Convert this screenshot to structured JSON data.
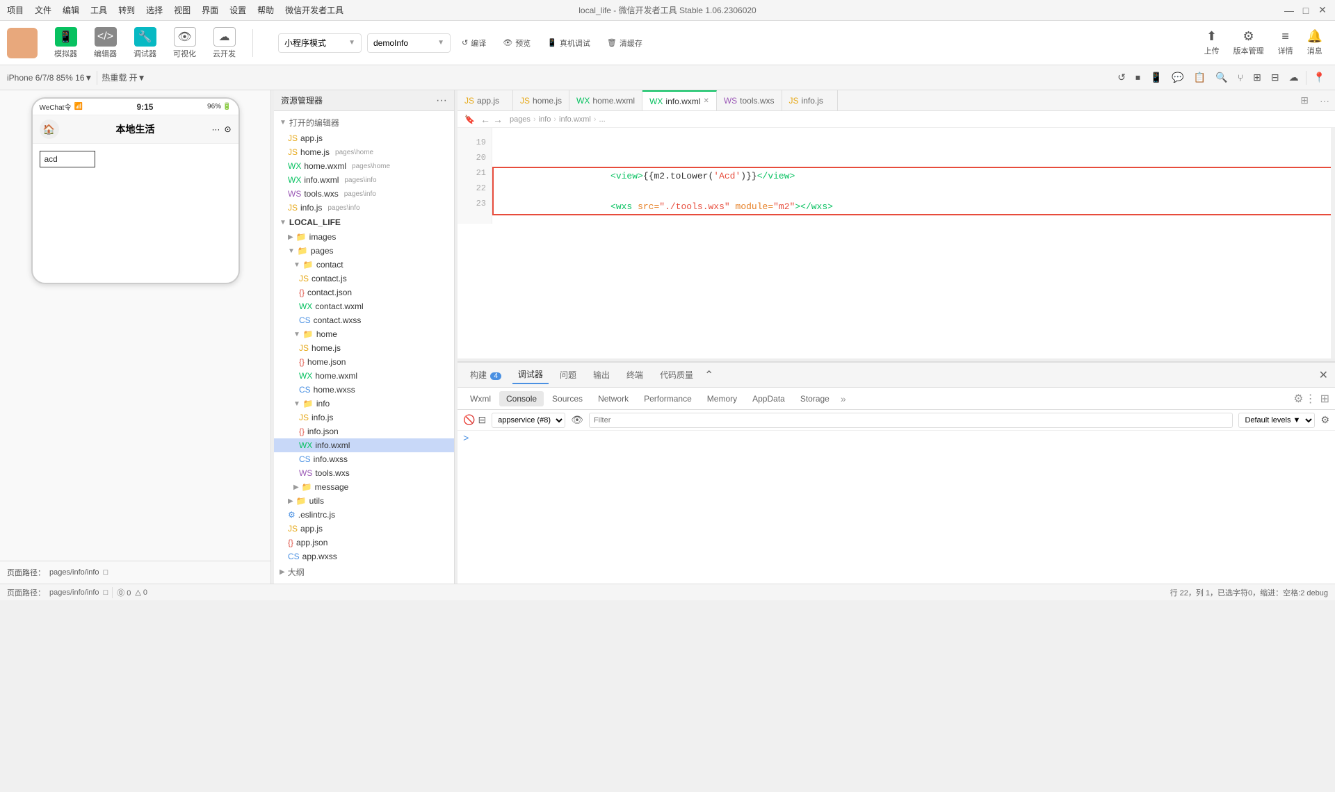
{
  "app": {
    "title": "local_life - 微信开发者工具 Stable 1.06.2306020",
    "menu_items": [
      "项目",
      "文件",
      "编辑",
      "工具",
      "转到",
      "选择",
      "视图",
      "界面",
      "设置",
      "帮助",
      "微信开发者工具"
    ]
  },
  "toolbar": {
    "simulator_label": "模拟器",
    "editor_label": "编辑器",
    "debug_label": "调试器",
    "visual_label": "可视化",
    "cloud_label": "云开发",
    "mode_label": "小程序模式",
    "project_label": "demoInfo",
    "compile_label": "编译",
    "preview_label": "预览",
    "realdev_label": "真机调试",
    "clearcache_label": "清缓存",
    "upload_label": "上传",
    "version_label": "版本管理",
    "details_label": "详情",
    "message_label": "消息"
  },
  "second_toolbar": {
    "device": "iPhone 6/7/8 85% 16▼",
    "hotreload": "热重载 开▼"
  },
  "phone": {
    "carrier": "WeChat令",
    "time": "9:15",
    "battery": "96%",
    "title": "本地生活",
    "content": "acd"
  },
  "filetree": {
    "header": "资源管理器",
    "open_editors": "打开的编辑器",
    "open_files": [
      {
        "name": "app.js",
        "type": "js"
      },
      {
        "name": "home.js",
        "path": "pages\\home",
        "type": "js"
      },
      {
        "name": "home.wxml",
        "path": "pages\\home",
        "type": "wxml"
      },
      {
        "name": "info.wxml",
        "path": "pages\\info",
        "type": "wxml"
      },
      {
        "name": "tools.wxs",
        "path": "pages\\info",
        "type": "wxs"
      },
      {
        "name": "info.js",
        "path": "pages\\info",
        "type": "js"
      }
    ],
    "project_name": "LOCAL_LIFE",
    "tree": [
      {
        "name": "images",
        "type": "folder-yellow",
        "depth": 1,
        "collapsed": true
      },
      {
        "name": "pages",
        "type": "folder-yellow",
        "depth": 1,
        "collapsed": false
      },
      {
        "name": "contact",
        "type": "folder-blue",
        "depth": 2,
        "collapsed": false
      },
      {
        "name": "contact.js",
        "type": "js",
        "depth": 3
      },
      {
        "name": "contact.json",
        "type": "json",
        "depth": 3
      },
      {
        "name": "contact.wxml",
        "type": "wxml",
        "depth": 3
      },
      {
        "name": "contact.wxss",
        "type": "wxss",
        "depth": 3
      },
      {
        "name": "home",
        "type": "folder-blue",
        "depth": 2,
        "collapsed": false
      },
      {
        "name": "home.js",
        "type": "js",
        "depth": 3
      },
      {
        "name": "home.json",
        "type": "json",
        "depth": 3
      },
      {
        "name": "home.wxml",
        "type": "wxml",
        "depth": 3
      },
      {
        "name": "home.wxss",
        "type": "wxss",
        "depth": 3
      },
      {
        "name": "info",
        "type": "folder-blue",
        "depth": 2,
        "collapsed": false
      },
      {
        "name": "info.js",
        "type": "js",
        "depth": 3
      },
      {
        "name": "info.json",
        "type": "json",
        "depth": 3
      },
      {
        "name": "info.wxml",
        "type": "wxml",
        "depth": 3,
        "selected": true
      },
      {
        "name": "info.wxss",
        "type": "wxss",
        "depth": 3
      },
      {
        "name": "tools.wxs",
        "type": "wxs",
        "depth": 3
      },
      {
        "name": "message",
        "type": "folder-blue",
        "depth": 2,
        "collapsed": true
      },
      {
        "name": "utils",
        "type": "folder-yellow",
        "depth": 1,
        "collapsed": true
      },
      {
        "name": ".eslintrc.js",
        "type": "eslint",
        "depth": 1
      },
      {
        "name": "app.js",
        "type": "js",
        "depth": 1
      },
      {
        "name": "app.json",
        "type": "json",
        "depth": 1
      },
      {
        "name": "app.wxss",
        "type": "wxss",
        "depth": 1
      }
    ]
  },
  "editor": {
    "tabs": [
      {
        "name": "app.js",
        "type": "js",
        "active": false
      },
      {
        "name": "home.js",
        "type": "js",
        "active": false
      },
      {
        "name": "home.wxml",
        "type": "wxml",
        "active": false
      },
      {
        "name": "info.wxml",
        "type": "wxml",
        "active": true
      },
      {
        "name": "tools.wxs",
        "type": "wxs",
        "active": false
      },
      {
        "name": "info.js",
        "type": "js",
        "active": false
      }
    ],
    "breadcrumb": "pages > info > info.wxml > ...",
    "lines": [
      {
        "num": 19,
        "content": ""
      },
      {
        "num": 20,
        "content": ""
      },
      {
        "num": 21,
        "content": "    <view>{{m2.toLower('Acd')}}</view>",
        "highlighted": true
      },
      {
        "num": 22,
        "content": ""
      },
      {
        "num": 23,
        "content": "    <wxs src=\"./tools.wxs\" module=\"m2\"></wxs>",
        "highlighted": true
      }
    ]
  },
  "devtools": {
    "tabs": [
      "构建",
      "调试器",
      "问题",
      "输出",
      "终端",
      "代码质量"
    ],
    "active_tab": "调试器",
    "build_badge": "4",
    "inner_tabs": [
      "Wxml",
      "Console",
      "Sources",
      "Network",
      "Performance",
      "Memory",
      "AppData",
      "Storage"
    ],
    "active_inner_tab": "Console",
    "more_label": "»",
    "appservice": "appservice (#8)",
    "filter_placeholder": "Filter",
    "level_options": [
      "Default levels"
    ],
    "console_arrow": ">"
  },
  "status_bar": {
    "path": "pages/info/info",
    "errors": "⓪ 0",
    "warnings": "△ 0",
    "line_info": "行 22，列 1，已选字符0，缩进：空格:2 debug"
  }
}
